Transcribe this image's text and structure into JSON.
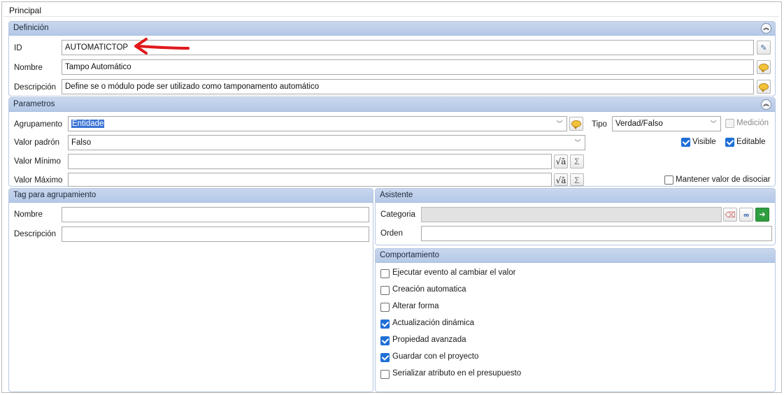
{
  "tab": {
    "title": "Principal"
  },
  "definicion": {
    "header": "Definición",
    "id_label": "ID",
    "id_value": "AUTOMATICTOP",
    "nombre_label": "Nombre",
    "nombre_value": "Tampo Automático",
    "descripcion_label": "Descripción",
    "descripcion_value": "Define se o módulo pode ser utilizado como tamponamento automático"
  },
  "parametros": {
    "header": "Parametros",
    "agrupamento_label": "Agrupamento",
    "agrupamento_value": "Entidade",
    "tipo_label": "Tipo",
    "tipo_value": "Verdad/Falso",
    "medicion_label": "Medición",
    "medicion_checked": false,
    "valor_padron_label": "Valor padrón",
    "valor_padron_value": "Falso",
    "visible_label": "Visible",
    "visible_checked": true,
    "editable_label": "Editable",
    "editable_checked": true,
    "valor_minimo_label": "Valor Mínimo",
    "valor_minimo_value": "",
    "valor_maximo_label": "Valor Máximo",
    "valor_maximo_value": "",
    "mantener_label": "Mantener valor de disociar",
    "mantener_checked": false
  },
  "tag": {
    "header": "Tag para agrupamiento",
    "nombre_label": "Nombre",
    "nombre_value": "",
    "descripcion_label": "Descripción",
    "descripcion_value": ""
  },
  "asistente": {
    "header": "Asistente",
    "categoria_label": "Categoria",
    "categoria_value": "",
    "orden_label": "Orden",
    "orden_value": ""
  },
  "comportamiento": {
    "header": "Comportamiento",
    "items": [
      {
        "label": "Ejecutar evento al cambiar el valor",
        "checked": false
      },
      {
        "label": "Creación automatica",
        "checked": false
      },
      {
        "label": "Alterar forma",
        "checked": false
      },
      {
        "label": "Actualización dinámica",
        "checked": true
      },
      {
        "label": "Propiedad avanzada",
        "checked": true
      },
      {
        "label": "Guardar con el proyecto",
        "checked": true
      },
      {
        "label": "Serializar atributo en el presupuesto",
        "checked": false
      }
    ]
  },
  "colors": {
    "accent": "#1f6fd6",
    "header_bg": "#c3d3ec",
    "annotation_arrow": "#e0191b"
  },
  "icons": {
    "collapse": "double-chevron-up-icon",
    "id_action": "edit-wand-icon",
    "translate": "speech-bubble-icon",
    "formula": "sqrt-formula-icon",
    "sum": "sigma-icon",
    "clear": "eraser-icon",
    "search": "binoculars-icon",
    "go": "green-arrow-icon"
  }
}
